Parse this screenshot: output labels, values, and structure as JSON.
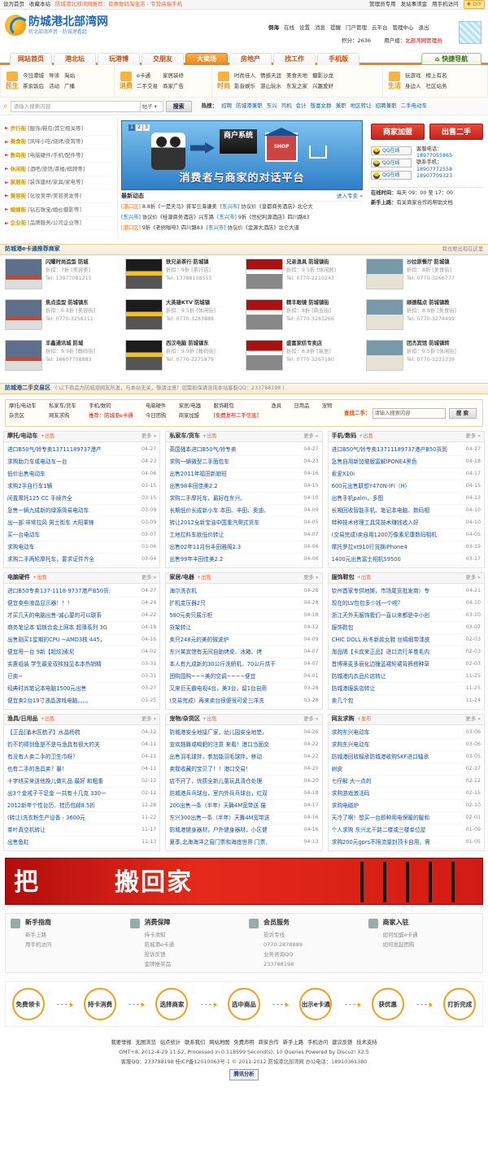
{
  "topbar": {
    "left": [
      "设为首页",
      "收藏本站"
    ],
    "notice": "防城港北部湾网推荐：普惠数码淘宝店 - 专营高端手机",
    "right": [
      "管理员专用",
      "发站事须金",
      "用手机访问"
    ],
    "diy": "DIY"
  },
  "logo": {
    "title": "防城港北部湾网",
    "sub": "听北部湾声音 · 防城港看起"
  },
  "user": {
    "name": "倒海",
    "status": "在线",
    "links": [
      "设置",
      "消息",
      "提醒",
      "门户管理",
      "云平台",
      "管理中心",
      "退出"
    ],
    "credits_label": "积分：",
    "credits": "2636",
    "usergroup_label": "用户组：",
    "usergroup": "北部湾网管理员"
  },
  "nav": {
    "tabs": [
      "网站首页",
      "港北坛",
      "玩港博",
      "交朋友",
      "大卖场",
      "房地产",
      "找工作",
      "手机版"
    ],
    "active": 4,
    "quick": "快捷导航"
  },
  "subnav": [
    {
      "label": "民生",
      "links": [
        "今日港城",
        "导读",
        "淘站",
        "茶余饭后",
        "活动",
        "广播"
      ]
    },
    {
      "label": "消费",
      "links": [
        "e卡通",
        "家居装修",
        "",
        "二手交易",
        "商家广告",
        ""
      ]
    },
    {
      "label": "时尚",
      "links": [
        "时尚佳人",
        "情感天涯",
        "美食天地",
        "影音娱乐",
        "游山玩水",
        "东友之家"
      ]
    },
    {
      "label": "",
      "links": [
        "摄影沙龙",
        "",
        "",
        "兴趣爱好",
        "",
        ""
      ]
    },
    {
      "label": "生活",
      "links": [
        "玩游戏",
        "榜上有名",
        "",
        "身边人",
        "社区站务",
        ""
      ]
    }
  ],
  "search": {
    "placeholder": "请输入搜索内容",
    "select": "帖子",
    "button": "搜索",
    "hot_label": "热搜：",
    "hot": [
      "招聘",
      "防城港兼职",
      "东兴",
      "司机",
      "会计",
      "殷富女群",
      "兼职",
      "地区转让",
      "招聘兼职",
      "二手电动车"
    ]
  },
  "streets": [
    {
      "name": "步行街",
      "desc": "[服饰/鞋包/其它相关等]"
    },
    {
      "name": "美食街",
      "desc": "[风味小吃/烧烤/夜宵等]"
    },
    {
      "name": "数码街",
      "desc": "[电脑硬件/手机/配件等]"
    },
    {
      "name": "休闲街",
      "desc": "[酒吧/旅馆/茶楼/棋牌等]"
    },
    {
      "name": "家居街",
      "desc": "[装饰建材/家具/家电等]"
    },
    {
      "name": "美容街",
      "desc": "[化妆美甲/美容美发等]"
    },
    {
      "name": "婚嫁街",
      "desc": "[钻石珠宝/婚纱摄影等]"
    },
    {
      "name": "企业街",
      "desc": "[品牌服务/公司企业等]"
    }
  ],
  "banner": {
    "pages": [
      "1",
      "2",
      "3"
    ],
    "system": "商户系统",
    "shop": "SHOP",
    "slogan": "消费者与商家的对话平台"
  },
  "news": {
    "title": "最新动态",
    "more": "进入专卖 »",
    "rows": [
      {
        "city": "[港口区]",
        "text": "8.8折《一是天马》蒋军兰海谦美"
      },
      {
        "city": "[东兴市]",
        "text": "协议价《皇都商务酒店》北仑大"
      },
      {
        "city": "[东兴市]",
        "text": "协议价《桂源商务酒店》兴东路"
      },
      {
        "city": "[东兴市]",
        "text": "9折《世纪利源酒店》四川路83"
      },
      {
        "city": "[港口区]",
        "text": "9折《老树咖啡》四川路83"
      },
      {
        "city": "[东兴市]",
        "text": "协议价《金源大酒店》北仑大道"
      }
    ]
  },
  "service": {
    "btn_join": "商家加盟",
    "btn_sell": "出售二手",
    "qq": [
      "QQ在线",
      "QQ在线",
      "QQ在线"
    ],
    "tel_label1": "客服电话：",
    "tel1": "18977055865",
    "tel_label2": "联系手机：",
    "tel2": "18907772558",
    "tel3": "18907709323",
    "worktime_label": "在线时间：",
    "worktime": "每天 09：00 至 17：00",
    "tip_label": "新手上路：",
    "tip": "有关商家合作的帮助文档"
  },
  "merchants_section": {
    "title": "防城港e卡通推荐商家",
    "more": "我也要出现在这里"
  },
  "merchants": [
    {
      "name": "闪耀时尚造型 防城",
      "discount": "折扣：7折",
      "type": "[美容美]",
      "tel": "Tel: 13977081215"
    },
    {
      "name": "轶兄弟茶行 防城镇",
      "discount": "折扣：9折",
      "type": "[茶行店]",
      "tel": "Tel: 13788108555"
    },
    {
      "name": "兄弟渔具 防城镇街",
      "discount": "折扣：9.5折",
      "type": "[休闲居]",
      "tel": "Tel: 0770-2210243"
    },
    {
      "name": "沙拉斯餐厅 防城镇",
      "discount": "折扣：8折",
      "type": "[美食街]",
      "tel": "Tel: 0770-3266777"
    },
    {
      "name": "焦点造型 防城镇东",
      "discount": "折扣：6.8折",
      "type": "[美容街]",
      "tel": "Tel: 0770-3258111"
    },
    {
      "name": "大英雄KTV 防城镇",
      "discount": "折扣：9.5折",
      "type": "[休闲街]",
      "tel": "Tel: 0770-3283888"
    },
    {
      "name": "精丰眼镜 防城镇街",
      "discount": "折扣：8折",
      "type": "[商业街]",
      "tel": "Tel: 0770-3283266"
    },
    {
      "name": "顺德糕点 防城镇教",
      "discount": "折扣：8.8折",
      "type": "[美食街]",
      "tel": "Tel: 0770-3274499"
    },
    {
      "name": "丰鑫通讯城 防城",
      "discount": "折扣：9.9折",
      "type": "[数码街]",
      "tel": "Tel: 18607708883"
    },
    {
      "name": "西汉电脑 防城镇东",
      "discount": "折扣：9.9折",
      "type": "[数码街]",
      "tel": "Tel: 0770-3275879"
    },
    {
      "name": "盛富家纺专卖店",
      "discount": "折扣：8.8折",
      "type": "[家居]",
      "tel": "Tel: 0770-3267180"
    },
    {
      "name": "团杰宾馆 防城镇转",
      "discount": "折扣：9.5折",
      "type": "[休闲街]",
      "tel": "Tel: 0770-3233339"
    }
  ],
  "trade_section": {
    "title": "防城港二手交易区",
    "note": "( 以下商品为防城港网友所发，与本站无关，敬请注意！如需担保请咨询本站客服QQ：233788198 )"
  },
  "trade_cats": [
    "摩托/电动车",
    "私家车/货车",
    "手机/数码",
    "电脑硬件",
    "家居/电器",
    "服饰鞋包",
    "渔具",
    "日用品",
    "宠物",
    "杂货区",
    "网友求购",
    "推荐：防城港e卡通",
    "今日团购",
    "商家加盟",
    "[免费发布二手信息]"
  ],
  "trade_search": {
    "label": "查找二手：",
    "placeholder": "请输入搜索内容",
    "button": "搜 索"
  },
  "boards": [
    {
      "title": "摩托/电动车",
      "post": "+出售",
      "more": "更多 »",
      "items": [
        {
          "t": "进口B50气/铃专卖13711189737港产",
          "d": "04-27"
        },
        {
          "t": "求购助力车或电动车一台",
          "d": "04-23"
        },
        {
          "t": "低价出售电动车",
          "d": "04-06"
        },
        {
          "t": "求购2手自行车1辆",
          "d": "03-15"
        },
        {
          "t": "闲置摩托125 CC 手续齐全",
          "d": "03-15"
        },
        {
          "t": "急售一辆九成新的绿源简易电动车",
          "d": "03-09"
        },
        {
          "t": "出一部 非常拉风 男士街车 大阳乘锋",
          "d": "03-09"
        },
        {
          "t": "买一台电动车",
          "d": "03-07"
        },
        {
          "t": "求购电动车",
          "d": "03-06"
        },
        {
          "t": "求购二手两轮摩托车，要求证件齐全",
          "d": "03-04"
        }
      ]
    },
    {
      "title": "私家车/货车",
      "post": "+出售",
      "more": "更多 »",
      "items": [
        {
          "t": "英国骚本进口B50气/铃专卖",
          "d": "04-27"
        },
        {
          "t": "求购一辆微型二手面包车",
          "d": "04-23"
        },
        {
          "t": "出售2011年福田新娘班",
          "d": "04-16"
        },
        {
          "t": "出售98丰田佳美2.2",
          "d": "04-15"
        },
        {
          "t": "求购二手摩托车，最好在东兴。",
          "d": "04-10"
        },
        {
          "t": "长期低价长成新小车 本田、丰田、奥迪、",
          "d": "04-09"
        },
        {
          "t": "转让2012全新宝油中国重汽爬式货车",
          "d": "04-05"
        },
        {
          "t": "工地拉料车欲低价转让",
          "d": "04-07"
        },
        {
          "t": "出售02年11月份丰田雅阁2.3",
          "d": "04-06"
        },
        {
          "t": "出售99年丰田佳美2.2",
          "d": "04-06"
        }
      ]
    },
    {
      "title": "手机/数码",
      "post": "+出售",
      "more": "更多 »",
      "items": [
        {
          "t": "进口B50气/铃专卖13711189737港产B50货到",
          "d": "04-27"
        },
        {
          "t": "急售自用新加坡版富解IPONE4黑色",
          "d": "04-18"
        },
        {
          "t": "索爱X10i",
          "d": "04-17"
        },
        {
          "t": "600元出售联想Y470N-IFI（H）",
          "d": "04-15"
        },
        {
          "t": "出售手机palm，多图",
          "d": "04-13"
        },
        {
          "t": "长期回收智能手机、笔记本电脑、数码相",
          "d": "04-10"
        },
        {
          "t": "特种技术修理工具凭技术赚钱收入好",
          "d": "04-10"
        },
        {
          "t": "(交易完成)卖自用1200万像素尼康数码相机",
          "d": "04-05"
        },
        {
          "t": "摩托罗拉xt910行货换iPhone4",
          "d": "03-19"
        },
        {
          "t": "1400元出售富士相机S9500",
          "d": "03-17"
        }
      ]
    },
    {
      "title": "电脑硬件",
      "post": "+出售",
      "more": "更多 »",
      "items": [
        {
          "t": "进口B50专卖137-1118-9737港产B50货:",
          "d": "04-27"
        },
        {
          "t": "便宜卖些液晶显示器！！！",
          "d": "04-24"
        },
        {
          "t": "才买几天的电脑出售-诚心要的可以联系",
          "d": "04-22"
        },
        {
          "t": "商务笔记本 铝镁合金上网本 超薄系列 3G",
          "d": "04-18"
        },
        {
          "t": "出售刚买1星期的CPU ~AMD3核 445，",
          "d": "04-16"
        },
        {
          "t": "便宜甩一台 9新【超炫]索尼",
          "d": "04-02"
        },
        {
          "t": "实惠组装 学生最爱双核独显本本热销精",
          "d": "03-31"
        },
        {
          "t": "已卖~",
          "d": "03-31"
        },
        {
          "t": "经典时尚笔记本电脑1500元出售",
          "d": "03-27"
        },
        {
          "t": "便宜卖2台19寸液晶游戏电脑。。。。",
          "d": "03-25"
        }
      ]
    },
    {
      "title": "家居/电器",
      "post": "+出售",
      "more": "更多 »",
      "items": [
        {
          "t": "海尔洗衣机",
          "d": "04-28"
        },
        {
          "t": "扩机变压器2只",
          "d": "04-28"
        },
        {
          "t": "580元卖只展示柜",
          "d": "04-18"
        },
        {
          "t": "货架转让",
          "d": "04-12"
        },
        {
          "t": "卖只248元的美的微波炉",
          "d": "04-09"
        },
        {
          "t": "东兴某宾馆有无间自助烤桌、冰箱、烤",
          "d": "04-07"
        },
        {
          "t": "本人有九成新的30公斤洗轿机、70公斤烘干",
          "d": "04-07"
        },
        {
          "t": "团购国购~~~美的空调~~~~便宜",
          "d": "04-01"
        },
        {
          "t": "又来巨无霸电视4台，美3台，留1台自用",
          "d": "03-28"
        },
        {
          "t": "(交易完成）再来卖台很便很可爱三洋洗",
          "d": "03-28"
        }
      ]
    },
    {
      "title": "服饰鞋包",
      "post": "+出售",
      "more": "更多 »",
      "items": [
        {
          "t": "钦州首家专供地摊，市场尾货批发商）专",
          "d": "04-21"
        },
        {
          "t": "现在的LV包包多少钱一个呢？",
          "d": "04-10"
        },
        {
          "t": "浙江天外天服饰我们一直以来都是中小创",
          "d": "03-10"
        },
        {
          "t": "服饰鞋包",
          "d": "03-07"
        },
        {
          "t": "CHIC DOLL 秋冬新款女鞋 丝绸缎带漆皮",
          "d": "02-03"
        },
        {
          "t": "淘品牌【卡宾来正品】进口流行羊卷毛内",
          "d": "02-03"
        },
        {
          "t": "首博蒂麦多丽化边撞蓝裙轮裙背裤搭种草",
          "d": "02-03"
        },
        {
          "t": "防城港内衣品片店转让",
          "d": "11-25"
        },
        {
          "t": "防城港服装店转让",
          "d": "11-25"
        },
        {
          "t": "卖几个包",
          "d": "11-24"
        }
      ]
    },
    {
      "title": "渔具/日用品",
      "post": "+出售",
      "more": "更多 »",
      "items": [
        {
          "t": "【正品]潘木匠梳子】水晶杨梳",
          "d": "04-12"
        },
        {
          "t": "钓不钓得到鱼是不是与渔具有很大的关",
          "d": "04-11"
        },
        {
          "t": "有没有人卖二手的卫生巾呀？",
          "d": "04-11"
        },
        {
          "t": "也有二手的渔具卖？暴！",
          "d": "04-11"
        },
        {
          "t": "十字绣买来送他挽儿做礼品 最好 和粗重",
          "d": "02-12"
        },
        {
          "t": "出3个金戒子干足金 一共有十几克 330一",
          "d": "02-12"
        },
        {
          "t": "2012新年个性台历、挂历包邮8.5折",
          "d": "12-28"
        },
        {
          "t": "(转让)洗衣粉生产设备 - 3600元",
          "d": "11-22"
        },
        {
          "t": "茶叶真空机转让",
          "d": "11-17"
        },
        {
          "t": "出售鱼缸",
          "d": "11-13"
        }
      ]
    },
    {
      "title": "宠物/杂货区",
      "post": "+出售",
      "more": "更多 »",
      "items": [
        {
          "t": "防城港安全地接厂家，幼儿园安全地垫，",
          "d": "04-26"
        },
        {
          "t": "宣欢翘舞或喝肥的注意 来看！港口当面交",
          "d": "04-22"
        },
        {
          "t": "出售羽毛球拌，参加能羽毛球拌，移动",
          "d": "04-22"
        },
        {
          "t": "卖我收藏的宝贝了！！港口交易！",
          "d": "04-20"
        },
        {
          "t": "店不开了，优质全新儿童玩具清仓处理",
          "d": "04-20"
        },
        {
          "t": "防城港兵乓球台，室内外兵乓球台，红双",
          "d": "04-18"
        },
        {
          "t": "200出售一条（半年）天舞4M宽带送 猫",
          "d": "04-17"
        },
        {
          "t": "东兴300出售一条（半年）天舞4M宽带送",
          "d": "04-16"
        },
        {
          "t": "防城港健身器材，户外健身器材，小区健",
          "d": "04-16"
        },
        {
          "t": "夏季,北海海洋之窗门票和海底世界 门票,",
          "d": "04-13"
        }
      ]
    },
    {
      "title": "网友求购",
      "post": "+发布",
      "more": "更多 »",
      "items": [
        {
          "t": "求购东兴电动车",
          "d": "03-06"
        },
        {
          "t": "求购东兴电动车",
          "d": "03-06"
        },
        {
          "t": "防城港回收输承防城港收购SKF进口轴承",
          "d": "03-05"
        },
        {
          "t": "树皮",
          "d": "02-27"
        },
        {
          "t": "七仔解 大一点的",
          "d": "02-22"
        },
        {
          "t": "求购游戏激活码",
          "d": "02-15"
        },
        {
          "t": "求购电磁炉",
          "d": "02-10"
        },
        {
          "t": "天冷了啊！想买一台即种用电保暖的暖和",
          "d": "02-01"
        },
        {
          "t": "个人求购 东兴北干路二楼或三楼单位屋",
          "d": "01-09"
        },
        {
          "t": "求购200元gprs不限流量封顶卡自用，需",
          "d": "01-05"
        }
      ]
    }
  ],
  "ad": {
    "left": "把",
    "middle": "搬回家"
  },
  "help": [
    {
      "title": "新手指南",
      "links": [
        "新手上路",
        "用手机访问"
      ]
    },
    {
      "title": "消费保障",
      "links": [
        "持卡须知",
        "防城港e卡通",
        "投诉反馈",
        "金牌推奖品"
      ]
    },
    {
      "title": "会员服务",
      "links": [
        "投诉专线",
        "0770-2878889",
        "业务咨询QQ",
        "233788198"
      ]
    },
    {
      "title": "商家入驻",
      "links": [
        "如何加盟e卡通",
        "如何发起团购"
      ]
    }
  ],
  "flow": [
    "免费领卡",
    "持卡消费",
    "选择商家",
    "选中商品",
    "出示e卡通",
    "获优惠",
    "打折完成"
  ],
  "footer": {
    "links": [
      "我要举报",
      "无图浏览",
      "站点统计",
      "联系我们",
      "网站地图",
      "免费声明",
      "商家合作",
      "新手上路",
      "手机访问",
      "建议反馈",
      "技术支持"
    ],
    "line2": "GMT+8, 2012-4-29 11:52, Processed in 0.118599 Second(s), 10 Queries Powered by Discuz! X2.5",
    "line3": "客服QQ：233788198 桂ICP备12010063号-1 © 2011-2012 防城港北部湾网 办公电话：18910361380",
    "badge": "腾讯分析"
  }
}
